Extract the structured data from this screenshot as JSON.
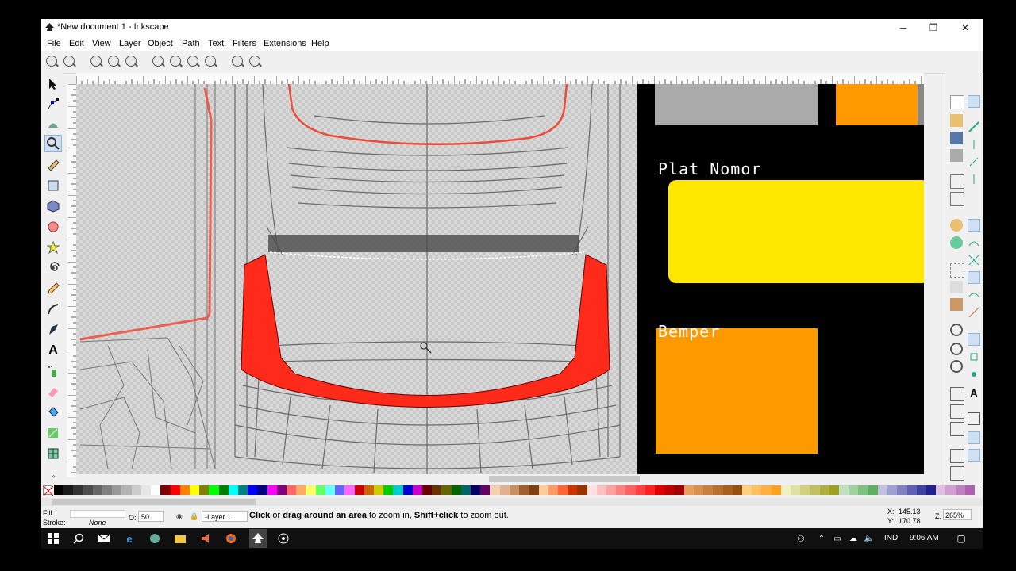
{
  "window": {
    "title": "*New document 1 - Inkscape",
    "controls": {
      "minimize": "─",
      "restore": "❐",
      "close": "✕"
    }
  },
  "menu": [
    "File",
    "Edit",
    "View",
    "Layer",
    "Object",
    "Path",
    "Text",
    "Filters",
    "Extensions",
    "Help"
  ],
  "canvas": {
    "labels": {
      "plat_nomor": "Plat Nomor",
      "bemper": "Bemper"
    },
    "colors": {
      "orange": "#ff9900",
      "yellow": "#ffe800",
      "gray": "#aaaaaa",
      "red": "#ff2a1a",
      "black": "#000000"
    }
  },
  "status": {
    "fill_label": "Fill:",
    "stroke_label": "Stroke:",
    "stroke_value": "None",
    "opacity_label": "O:",
    "opacity_value": "50",
    "layer": "-Layer 1",
    "message_bold1": "Click",
    "message_mid1": " or ",
    "message_bold2": "drag around an area",
    "message_mid2": " to zoom in, ",
    "message_bold3": "Shift+click",
    "message_end": " to zoom out.",
    "x_label": "X:",
    "x_value": "145.13",
    "y_label": "Y:",
    "y_value": "170.78",
    "z_label": "Z:",
    "zoom": "265%"
  },
  "taskbar": {
    "language": "IND",
    "time": "9:06 AM"
  },
  "icons": [
    "select-tool-icon",
    "node-tool-icon",
    "tweak-tool-icon",
    "zoom-tool-icon",
    "measure-tool-icon",
    "rect-tool-icon",
    "3dbox-tool-icon",
    "ellipse-tool-icon",
    "star-tool-icon",
    "spiral-tool-icon",
    "pencil-tool-icon",
    "pen-tool-icon",
    "calligraphy-tool-icon",
    "text-tool-icon",
    "spray-tool-icon",
    "eraser-tool-icon",
    "bucket-tool-icon",
    "gradient-tool-icon",
    "mesh-tool-icon"
  ]
}
